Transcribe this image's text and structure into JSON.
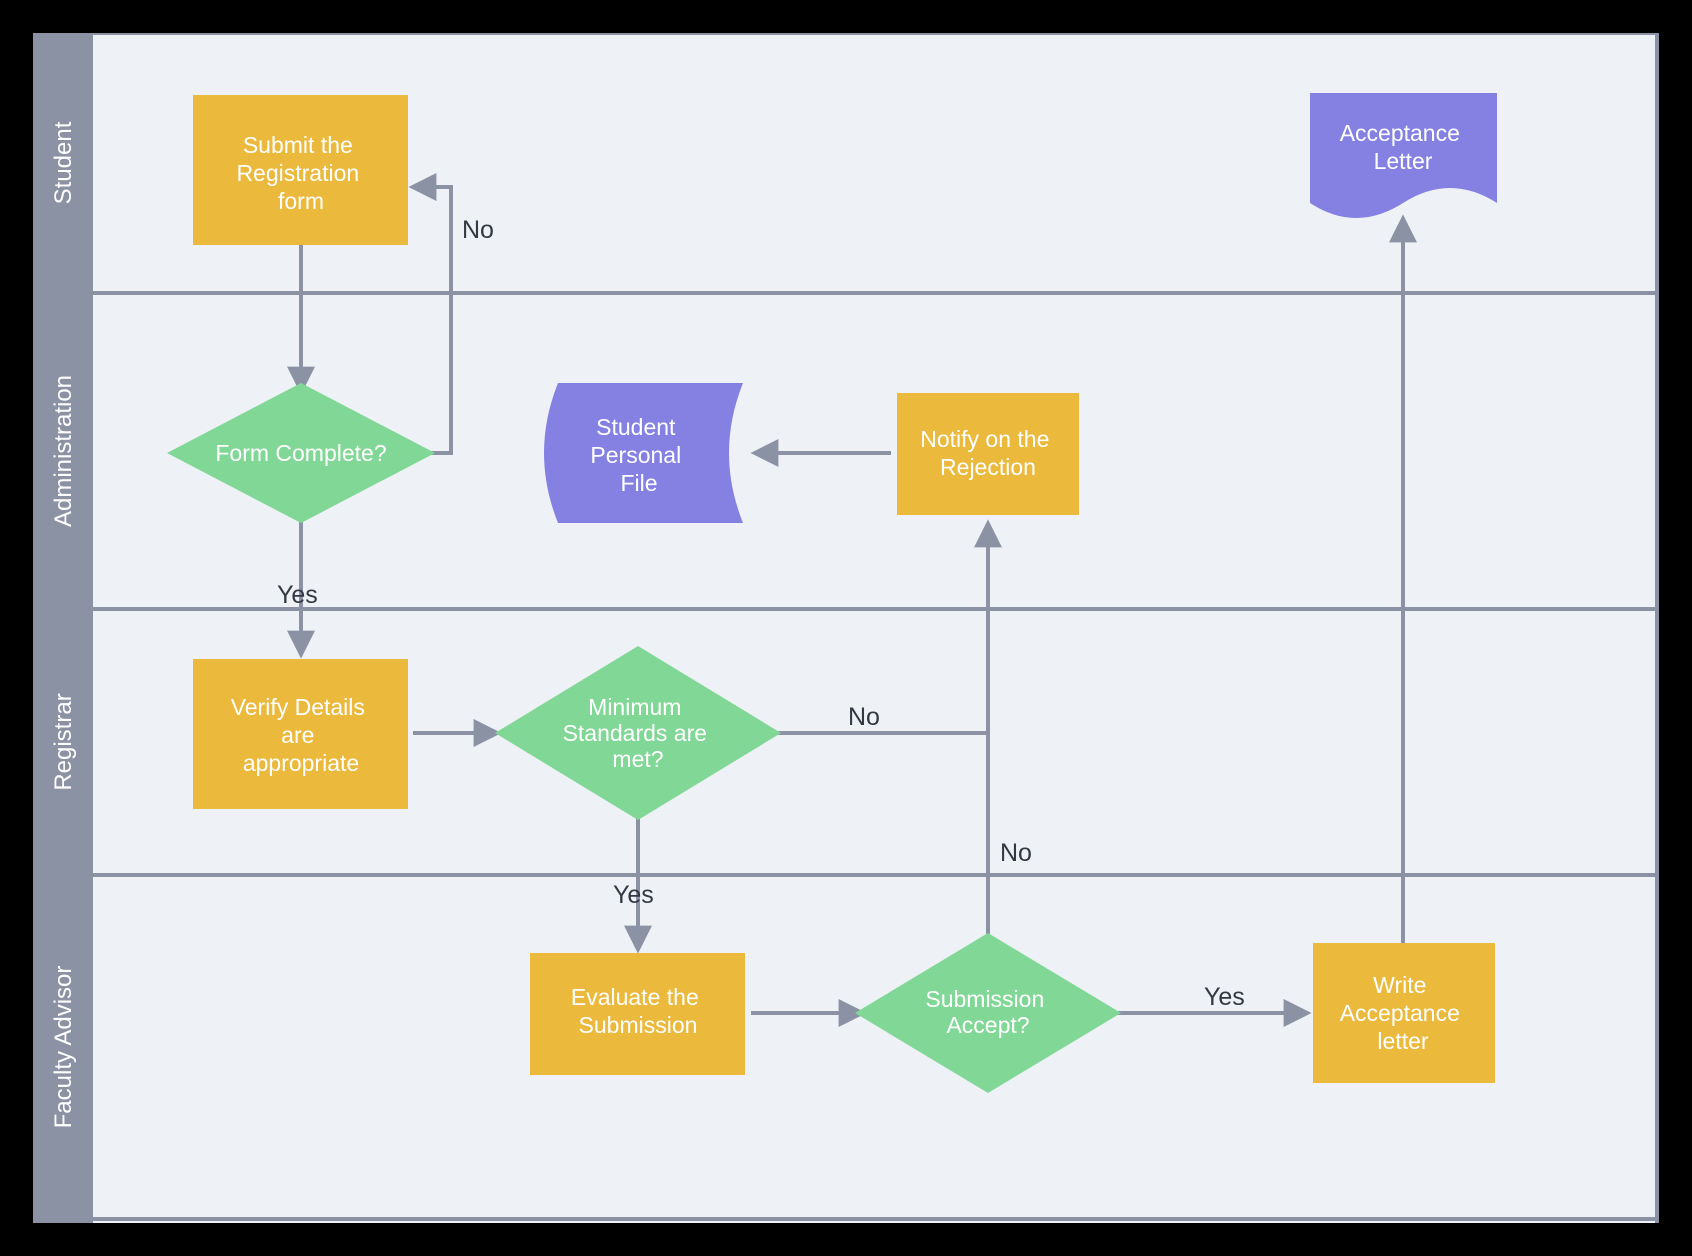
{
  "lanes": {
    "student": "Student",
    "administration": "Administration",
    "registrar": "Registrar",
    "faculty_advisor": "Faculty Advisor"
  },
  "nodes": {
    "submit_registration": "Submit the Registration form",
    "form_complete": "Form Complete?",
    "verify_details": "Verify Details are appropriate",
    "min_standards": "Minimum Standards  are met?",
    "notify_rejection": "Notify on the Rejection",
    "student_file": "Student Personal File",
    "evaluate_submission": "Evaluate the Submission",
    "submission_accept": "Submission Accept?",
    "write_acceptance": "Write Acceptance letter",
    "acceptance_letter": "Acceptance Letter"
  },
  "edge_labels": {
    "no1": "No",
    "yes1": "Yes",
    "no2": "No",
    "yes2": "Yes",
    "no3": "No",
    "yes3": "Yes"
  },
  "colors": {
    "lane_header": "#8b92a4",
    "rule": "#8b92a4",
    "process": "#ebb93c",
    "decision": "#81d896",
    "document": "#8481e3",
    "arrow": "#8b92a4"
  }
}
